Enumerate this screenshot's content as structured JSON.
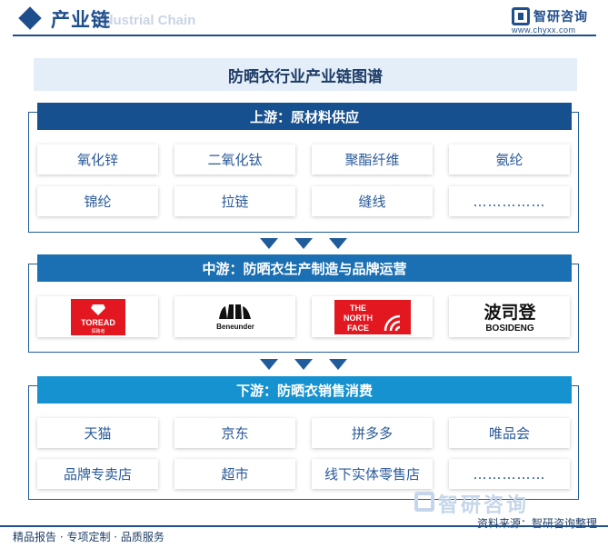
{
  "header": {
    "title": "产业链",
    "subtitle": "Industrial Chain",
    "logo_text": "智研咨询",
    "logo_url": "www.chyxx.com"
  },
  "diagram": {
    "title": "防晒衣行业产业链图谱",
    "upstream": {
      "label": "上游：原材料供应",
      "items": [
        "氧化锌",
        "二氧化钛",
        "聚酯纤维",
        "氨纶",
        "锦纶",
        "拉链",
        "缝线",
        "……………"
      ]
    },
    "midstream": {
      "label": "中游：防晒衣生产制造与品牌运营",
      "brands": [
        {
          "name": "TOREAD",
          "sub": "探路者"
        },
        {
          "name": "Beneunder"
        },
        {
          "name_line1": "THE",
          "name_line2": "NORTH",
          "name_line3": "FACE"
        },
        {
          "name_cn": "波司登",
          "name_en": "BOSIDENG"
        }
      ]
    },
    "downstream": {
      "label": "下游：防晒衣销售消费",
      "items": [
        "天猫",
        "京东",
        "拼多多",
        "唯品会",
        "品牌专卖店",
        "超市",
        "线下实体零售店",
        "……………"
      ]
    }
  },
  "footer": {
    "left": "精品报告 · 专项定制 · 品质服务",
    "source": "资料来源：智研咨询整理",
    "watermark": "智研咨询"
  },
  "colors": {
    "primary": "#1f4e8c",
    "upstream_bar": "#17508e",
    "midstream_bar": "#1b6fb3",
    "downstream_bar": "#1592cf",
    "card_text": "#2a5a9a",
    "brand_red": "#e3171f"
  }
}
